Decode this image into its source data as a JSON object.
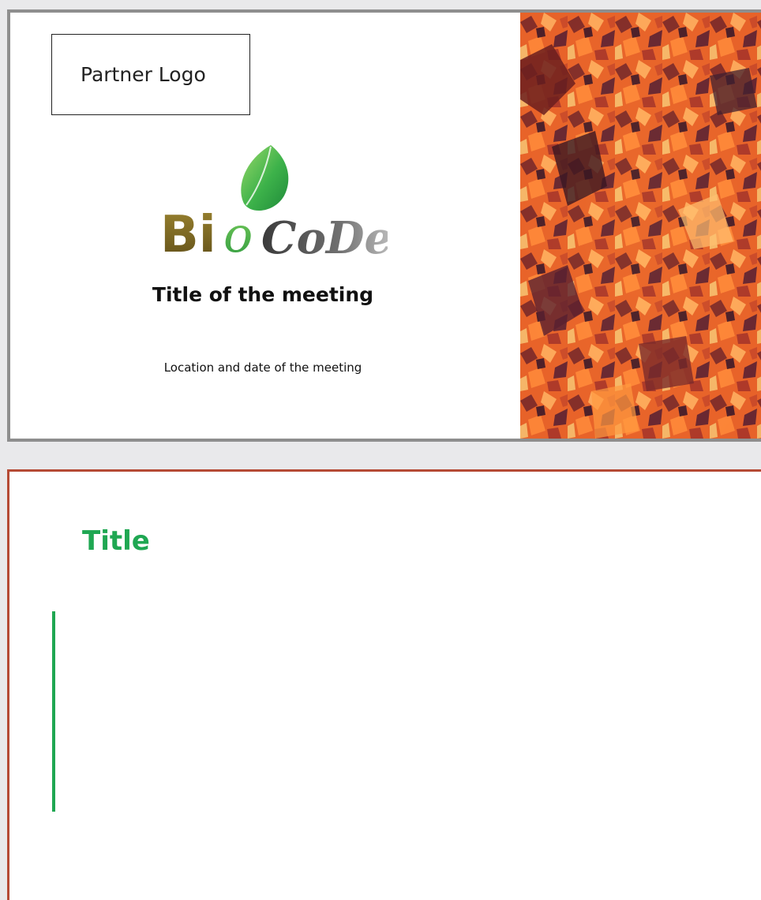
{
  "slide1": {
    "partner_logo_label": "Partner Logo",
    "brand": {
      "part1": "Bi",
      "part2": "o",
      "part3": "CoDe"
    },
    "meeting_title": "Title of the meeting",
    "meeting_subtitle": "Location and date of the meeting"
  },
  "slide2": {
    "title": "Title"
  },
  "colors": {
    "accent_green": "#1fa752",
    "slide2_border": "#b54a35",
    "slide1_border": "#8e8e8e",
    "brand_olive": "#7d6a24"
  },
  "icons": {
    "leaf": "leaf-icon",
    "photo": "lava-rock-photo"
  }
}
